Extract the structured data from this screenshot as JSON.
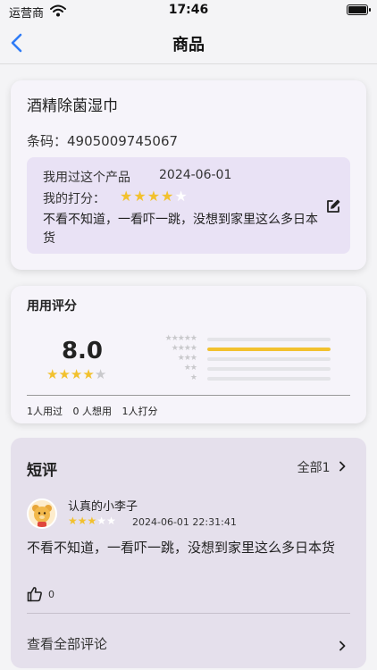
{
  "status_bar": {
    "carrier": "运营商",
    "time": "17:46",
    "wifi_icon": "wifi-icon",
    "battery_icon": "battery-icon"
  },
  "nav": {
    "title": "商品",
    "back_icon": "chevron-left-icon"
  },
  "product": {
    "name": "酒精除菌湿巾",
    "barcode": "条码：4905009745067",
    "my_review": {
      "used_label": "我用过这个产品",
      "used_date": "2024-06-01",
      "score_label": "我的打分：",
      "stars": 4,
      "max_stars": 5,
      "text": "不看不知道，一看吓一跳，没想到家里这么多日本货",
      "edit_icon": "edit-icon"
    }
  },
  "rating": {
    "title": "用用评分",
    "score": "8.0",
    "stars": 4,
    "max_stars": 5,
    "distribution": [
      {
        "stars": 5,
        "fraction": 0
      },
      {
        "stars": 4,
        "fraction": 1
      },
      {
        "stars": 3,
        "fraction": 0
      },
      {
        "stars": 2,
        "fraction": 0
      },
      {
        "stars": 1,
        "fraction": 0
      }
    ],
    "stats": {
      "used": "1人用过",
      "want": "0 人想用",
      "rated": "1人打分"
    }
  },
  "short_reviews": {
    "title": "短评",
    "all_label": "全部1",
    "items": [
      {
        "name": "认真的小李子",
        "stars": 3,
        "max_stars": 5,
        "time": "2024-06-01 22:31:41",
        "text": "不看不知道，一看吓一跳，没想到家里这么多日本货",
        "likes": "0",
        "avatar_icon": "bear-avatar-icon",
        "like_icon": "thumbs-up-icon"
      }
    ],
    "view_all_label": "查看全部评论"
  },
  "colors": {
    "star": "#f2c12e",
    "card": "#f6f4fa",
    "my_review_bg": "#e9e2f5",
    "short_bg": "#e5e0ec",
    "accent": "#2f7cf6"
  }
}
